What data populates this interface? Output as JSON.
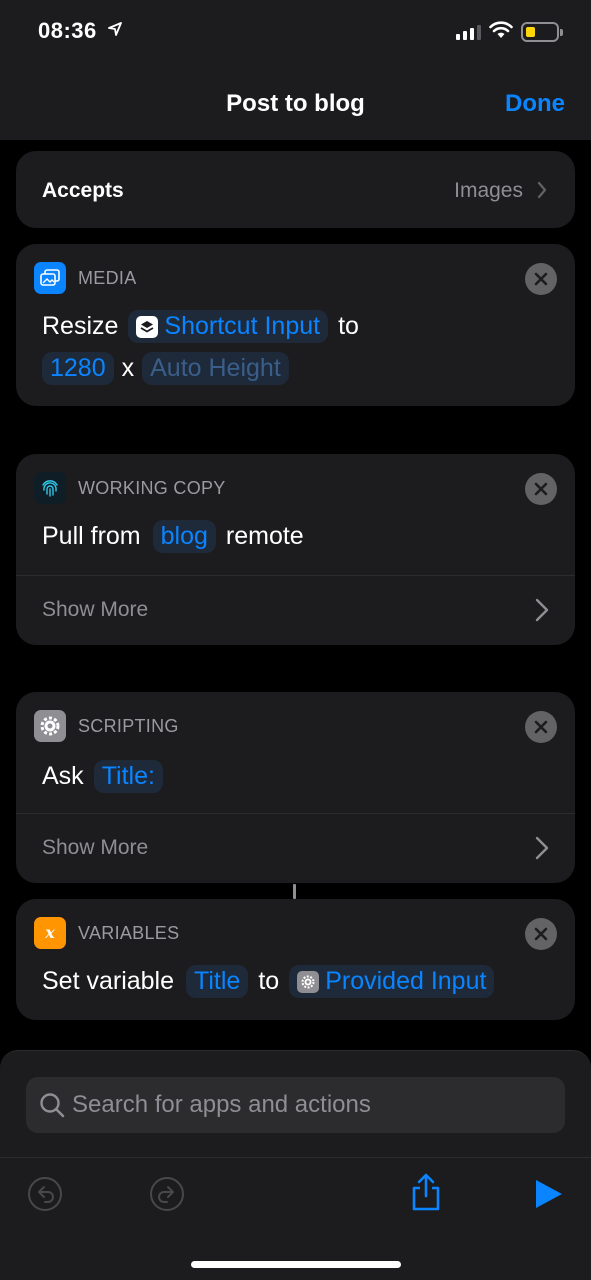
{
  "status_bar": {
    "time": "08:36"
  },
  "nav": {
    "title": "Post to blog",
    "done_label": "Done"
  },
  "accepts": {
    "label": "Accepts",
    "value": "Images"
  },
  "actions": {
    "media": {
      "category": "MEDIA",
      "line1": {
        "verb": "Resize",
        "input_token": "Shortcut Input",
        "to": "to"
      },
      "line2": {
        "width": "1280",
        "x": "x",
        "height_placeholder": "Auto Height"
      }
    },
    "working_copy": {
      "category": "WORKING COPY",
      "line": {
        "verb": "Pull from",
        "repo": "blog",
        "suffix": "remote"
      },
      "show_more": "Show More"
    },
    "scripting": {
      "category": "SCRIPTING",
      "line": {
        "verb": "Ask",
        "prompt": "Title:"
      },
      "show_more": "Show More"
    },
    "variables": {
      "category": "VARIABLES",
      "line": {
        "verb": "Set variable",
        "name": "Title",
        "to": "to",
        "value": "Provided Input"
      }
    }
  },
  "search": {
    "placeholder": "Search for apps and actions"
  },
  "colors": {
    "accent": "#0a84ff",
    "variables_icon": "#ff9500",
    "media_icon": "#0a84ff",
    "battery": "#ffd60a"
  },
  "icons": {
    "media": "photo-icon",
    "working_copy": "fingerprint-icon",
    "scripting": "gear-icon",
    "variables": "x-variable-icon"
  }
}
